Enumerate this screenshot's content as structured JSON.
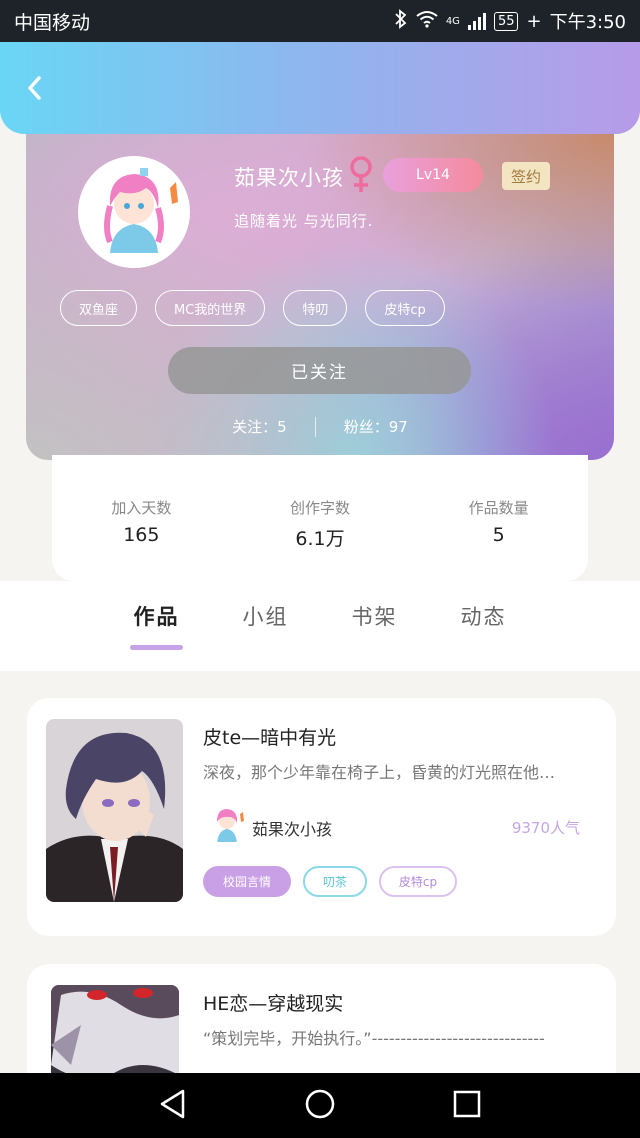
{
  "status_bar": {
    "carrier": "中国移动",
    "network": "4G",
    "battery": "55",
    "time": "下午3:50"
  },
  "profile": {
    "name": "茹果次小孩",
    "level": "Lv14",
    "sign_badge": "签约",
    "motto": "追随着光 与光同行.",
    "tags": [
      "双鱼座",
      "MC我的世界",
      "特叨",
      "皮特cp"
    ],
    "follow_button": "已关注",
    "following": "关注：5",
    "fans": "粉丝：97"
  },
  "stats": [
    {
      "label": "加入天数",
      "value": "165"
    },
    {
      "label": "创作字数",
      "value": "6.1万"
    },
    {
      "label": "作品数量",
      "value": "5"
    }
  ],
  "tabs": [
    "作品",
    "小组",
    "书架",
    "动态"
  ],
  "active_tab": "作品",
  "books": [
    {
      "title": "皮te—暗中有光",
      "desc": "深夜，那个少年靠在椅子上，昏黄的灯光照在他…",
      "author": "茹果次小孩",
      "popularity": "9370人气",
      "tags": [
        "校园言情",
        "叨茶",
        "皮特cp"
      ]
    },
    {
      "title": "HE恋—穿越现实",
      "desc": "“策划完毕，开始执行。”------------------------------"
    }
  ],
  "colors": {
    "accent_purple": "#c6a2e6",
    "header_start": "#6ad6f5",
    "header_end": "#b79be8"
  }
}
